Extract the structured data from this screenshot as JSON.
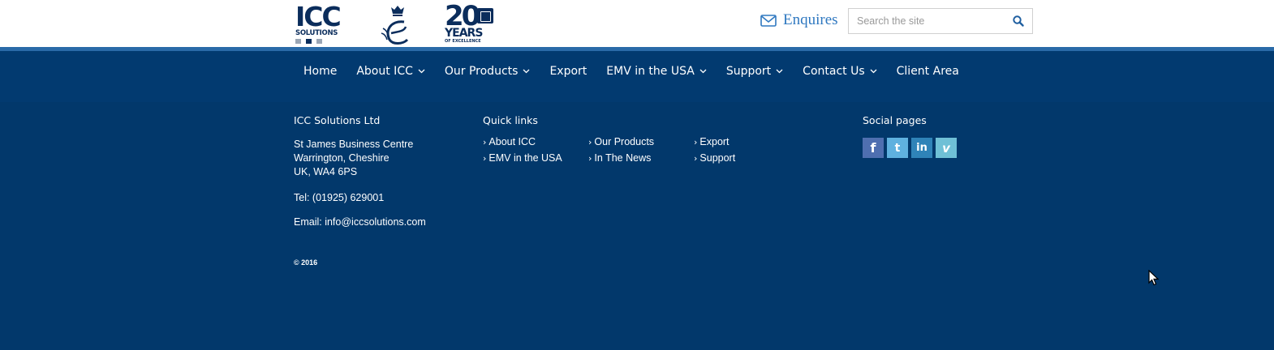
{
  "header": {
    "logos": {
      "icc_big": "ICC",
      "icc_small": "SOLUTIONS",
      "years_number": "20",
      "years_word": "YEARS",
      "years_tag": "OF EXCELLENCE"
    },
    "enquires_label": "Enquires",
    "search_placeholder": "Search the site"
  },
  "nav": {
    "items": [
      {
        "label": "Home"
      },
      {
        "label": "About ICC"
      },
      {
        "label": "Our Products"
      },
      {
        "label": "Export"
      },
      {
        "label": "EMV in the USA"
      },
      {
        "label": "Support"
      },
      {
        "label": "Contact Us"
      },
      {
        "label": "Client Area"
      }
    ]
  },
  "footer": {
    "company": {
      "heading": "ICC Solutions Ltd",
      "address_line1": "St James Business Centre",
      "address_line2": "Warrington, Cheshire",
      "address_line3": "UK, WA4 6PS",
      "tel": "Tel: (01925) 629001",
      "email": "Email: info@iccsolutions.com",
      "copyright": "© 2016"
    },
    "quick_links": {
      "heading": "Quick links",
      "links": [
        {
          "label": "About ICC"
        },
        {
          "label": "Our Products"
        },
        {
          "label": "Export"
        },
        {
          "label": "EMV in the USA"
        },
        {
          "label": "In The News"
        },
        {
          "label": "Support"
        }
      ]
    },
    "social": {
      "heading": "Social pages",
      "icons": [
        {
          "name": "facebook-icon",
          "glyph": "f"
        },
        {
          "name": "twitter-icon",
          "glyph": "t"
        },
        {
          "name": "linkedin-icon",
          "glyph": "in"
        },
        {
          "name": "vimeo-icon",
          "glyph": "v"
        }
      ]
    }
  },
  "colors": {
    "footer_bg": "#023a70",
    "accent_line": "#2a6aa8",
    "link_blue": "#2f78c0",
    "logo_navy": "#0b2d5c"
  }
}
